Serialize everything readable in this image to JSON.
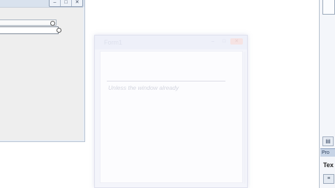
{
  "background_window": {
    "caption_buttons": [
      "–",
      "□",
      "✕"
    ]
  },
  "dialog": {
    "title": "Form1",
    "caption_buttons": [
      "–",
      "□",
      "✕"
    ],
    "watermark": "Unless the window already"
  },
  "right_panel": {
    "tab_label": "Pro",
    "text_label": "Tex",
    "tool_glyph": "▤",
    "bottom_glyph": "≡"
  }
}
